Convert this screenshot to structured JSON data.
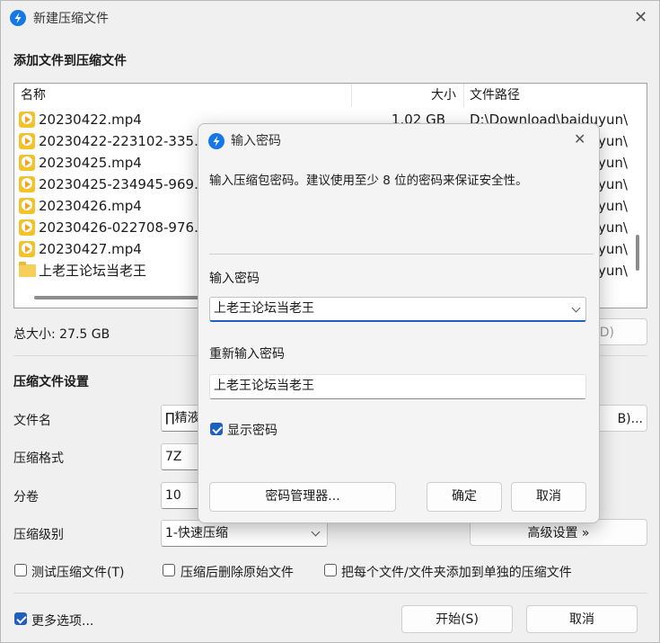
{
  "main": {
    "title": "新建压缩文件",
    "add_heading": "添加文件到压缩文件",
    "columns": {
      "name": "名称",
      "size": "大小",
      "path": "文件路径"
    },
    "files": [
      {
        "name": "20230422.mp4",
        "size": "1.02 GB",
        "path": "D:\\Download\\baiduyun\\",
        "type": "video"
      },
      {
        "name": "20230422-223102-335.mp4",
        "size": "",
        "path": "yun\\",
        "type": "video"
      },
      {
        "name": "20230425.mp4",
        "size": "",
        "path": "yun\\",
        "type": "video"
      },
      {
        "name": "20230425-234945-969.mp4",
        "size": "",
        "path": "yun\\",
        "type": "video"
      },
      {
        "name": "20230426.mp4",
        "size": "",
        "path": "yun\\",
        "type": "video"
      },
      {
        "name": "20230426-022708-976.mp4",
        "size": "",
        "path": "yun\\",
        "type": "video"
      },
      {
        "name": "20230427.mp4",
        "size": "",
        "path": "yun\\",
        "type": "video"
      },
      {
        "name": "上老王论坛当老王",
        "size": "",
        "path": "yun\\",
        "type": "folder"
      }
    ],
    "total_size": "总大小: 27.5 GB",
    "hidden_button_fragment": "D)",
    "settings_heading": "压缩文件设置",
    "filename_label": "文件名",
    "filename_value": "∏精液",
    "browse_fragment": "B)...",
    "format_label": "压缩格式",
    "format_value": "7Z",
    "volume_label": "分卷",
    "volume_value": "10",
    "level_label": "压缩级别",
    "level_value": "1-快速压缩",
    "advanced_button": "高级设置 »",
    "check_test": "测试压缩文件(T)",
    "check_delete": "压缩后删除原始文件",
    "check_separate": "把每个文件/文件夹添加到单独的压缩文件",
    "more_options": "更多选项...",
    "start_button": "开始(S)",
    "cancel_button": "取消"
  },
  "dialog": {
    "title": "输入密码",
    "description": "输入压缩包密码。建议使用至少 8 位的密码来保证安全性。",
    "password_label": "输入密码",
    "password_value": "上老王论坛当老王",
    "confirm_label": "重新输入密码",
    "confirm_value": "上老王论坛当老王",
    "show_password": "显示密码",
    "manager_button": "密码管理器...",
    "ok_button": "确定",
    "cancel_button": "取消"
  },
  "colors": {
    "accent": "#1f5fbf",
    "app_icon": "#1677e6",
    "video_icon": "#f3c22b"
  }
}
